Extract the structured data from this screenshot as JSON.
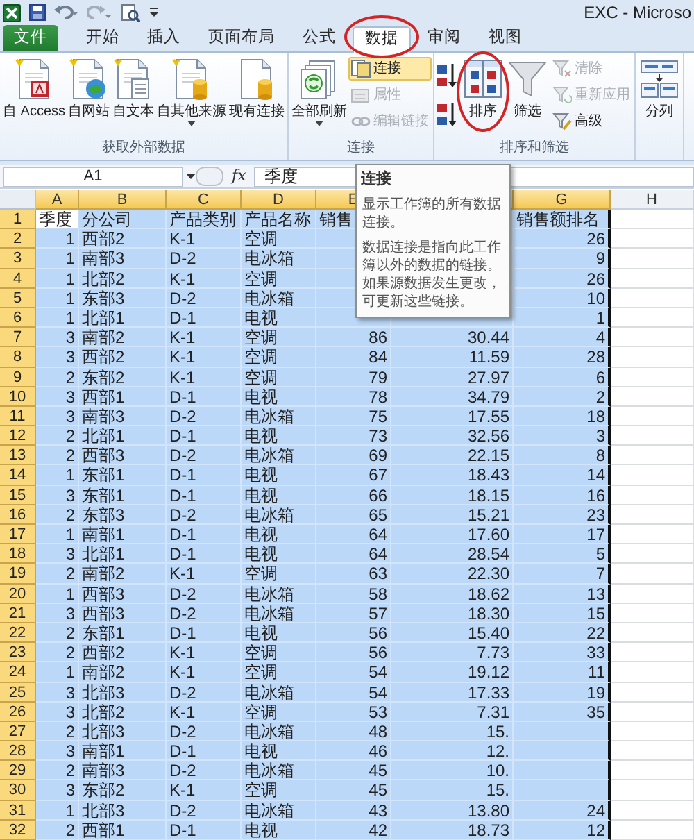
{
  "title_bar": {
    "title": "EXC - Microso"
  },
  "tabs": [
    {
      "label": "文件",
      "kind": "file",
      "selected": false
    },
    {
      "label": "开始",
      "kind": "tab",
      "selected": false
    },
    {
      "label": "插入",
      "kind": "tab",
      "selected": false
    },
    {
      "label": "页面布局",
      "kind": "tab",
      "selected": false
    },
    {
      "label": "公式",
      "kind": "tab",
      "selected": false
    },
    {
      "label": "数据",
      "kind": "tab",
      "selected": true,
      "circled": true
    },
    {
      "label": "审阅",
      "kind": "tab",
      "selected": false
    },
    {
      "label": "视图",
      "kind": "tab",
      "selected": false
    }
  ],
  "ribbon": {
    "groups": [
      {
        "label": "获取外部数据",
        "items": [
          {
            "kind": "large",
            "label": "自 Access",
            "dropdown": false
          },
          {
            "kind": "large",
            "label": "自网站",
            "dropdown": false
          },
          {
            "kind": "large",
            "label": "自文本",
            "dropdown": false
          },
          {
            "kind": "large",
            "label": "自其他来源",
            "dropdown": true
          },
          {
            "kind": "large",
            "label": "现有连接",
            "dropdown": false
          }
        ]
      },
      {
        "label": "连接",
        "items": [
          {
            "kind": "large",
            "label": "全部刷新",
            "dropdown": true
          },
          {
            "kind": "stack",
            "buttons": [
              {
                "label": "连接",
                "disabled": false,
                "highlighted": true
              },
              {
                "label": "属性",
                "disabled": true,
                "highlighted": false
              },
              {
                "label": "编辑链接",
                "disabled": true,
                "highlighted": false
              }
            ]
          }
        ]
      },
      {
        "label": "排序和筛选",
        "items": [
          {
            "kind": "icons",
            "buttons": [
              {
                "disabled": false
              },
              {
                "disabled": false
              }
            ]
          },
          {
            "kind": "large",
            "label": "排序",
            "dropdown": false,
            "circled": true
          },
          {
            "kind": "large",
            "label": "筛选",
            "dropdown": false
          },
          {
            "kind": "stack",
            "buttons": [
              {
                "label": "清除",
                "disabled": true,
                "highlighted": false
              },
              {
                "label": "重新应用",
                "disabled": true,
                "highlighted": false
              },
              {
                "label": "高级",
                "disabled": false,
                "highlighted": false
              }
            ]
          }
        ]
      },
      {
        "items": [
          {
            "kind": "large",
            "label": "分列",
            "dropdown": false
          }
        ]
      }
    ]
  },
  "formula_bar": {
    "name_box": "A1",
    "function_label": "fx",
    "formula": "季度"
  },
  "tooltip": {
    "title": "连接",
    "paragraphs": [
      "显示工作簿的所有数据连接。",
      "数据连接是指向此工作簿以外的数据的链接。如果源数据发生更改，可更新这些链接。"
    ]
  },
  "columns": [
    {
      "label": "A",
      "selected": true,
      "kind": "number"
    },
    {
      "label": "B",
      "selected": true,
      "kind": "text"
    },
    {
      "label": "C",
      "selected": true,
      "kind": "text"
    },
    {
      "label": "D",
      "selected": true,
      "kind": "text"
    },
    {
      "label": "E",
      "selected": true,
      "kind": "number"
    },
    {
      "selected": true,
      "kind": "number"
    },
    {
      "label": "G",
      "selected": true,
      "kind": "number"
    },
    {
      "label": "H",
      "selected": false,
      "kind": "text"
    }
  ],
  "rows": [
    {
      "header": "1",
      "kind": "header",
      "selected": true,
      "cells": [
        "季度",
        "分公司",
        "产品类别",
        "产品名称",
        "销售",
        null,
        "销售额排名"
      ]
    },
    {
      "header": "2",
      "kind": "data",
      "selected": true,
      "cells": [
        "1",
        "西部2",
        "K-1",
        "空调",
        null,
        null,
        "26"
      ]
    },
    {
      "header": "3",
      "kind": "data",
      "selected": true,
      "cells": [
        "1",
        "南部3",
        "D-2",
        "电冰箱",
        null,
        null,
        "9"
      ]
    },
    {
      "header": "4",
      "kind": "data",
      "selected": true,
      "cells": [
        "1",
        "北部2",
        "K-1",
        "空调",
        null,
        null,
        "26"
      ]
    },
    {
      "header": "5",
      "kind": "data",
      "selected": true,
      "cells": [
        "1",
        "东部3",
        "D-2",
        "电冰箱",
        null,
        null,
        "10"
      ]
    },
    {
      "header": "6",
      "kind": "data",
      "selected": true,
      "cells": [
        "1",
        "北部1",
        "D-1",
        "电视",
        null,
        null,
        "1"
      ]
    },
    {
      "header": "7",
      "kind": "data",
      "selected": true,
      "cells": [
        "3",
        "南部2",
        "K-1",
        "空调",
        "86",
        "30.44",
        "4"
      ]
    },
    {
      "header": "8",
      "kind": "data",
      "selected": true,
      "cells": [
        "3",
        "西部2",
        "K-1",
        "空调",
        "84",
        "11.59",
        "28"
      ]
    },
    {
      "header": "9",
      "kind": "data",
      "selected": true,
      "cells": [
        "2",
        "东部2",
        "K-1",
        "空调",
        "79",
        "27.97",
        "6"
      ]
    },
    {
      "header": "10",
      "kind": "data",
      "selected": true,
      "cells": [
        "3",
        "西部1",
        "D-1",
        "电视",
        "78",
        "34.79",
        "2"
      ]
    },
    {
      "header": "11",
      "kind": "data",
      "selected": true,
      "cells": [
        "3",
        "南部3",
        "D-2",
        "电冰箱",
        "75",
        "17.55",
        "18"
      ]
    },
    {
      "header": "12",
      "kind": "data",
      "selected": true,
      "cells": [
        "2",
        "北部1",
        "D-1",
        "电视",
        "73",
        "32.56",
        "3"
      ]
    },
    {
      "header": "13",
      "kind": "data",
      "selected": true,
      "cells": [
        "2",
        "西部3",
        "D-2",
        "电冰箱",
        "69",
        "22.15",
        "8"
      ]
    },
    {
      "header": "14",
      "kind": "data",
      "selected": true,
      "cells": [
        "1",
        "东部1",
        "D-1",
        "电视",
        "67",
        "18.43",
        "14"
      ]
    },
    {
      "header": "15",
      "kind": "data",
      "selected": true,
      "cells": [
        "3",
        "东部1",
        "D-1",
        "电视",
        "66",
        "18.15",
        "16"
      ]
    },
    {
      "header": "16",
      "kind": "data",
      "selected": true,
      "cells": [
        "2",
        "东部3",
        "D-2",
        "电冰箱",
        "65",
        "15.21",
        "23"
      ]
    },
    {
      "header": "17",
      "kind": "data",
      "selected": true,
      "cells": [
        "1",
        "南部1",
        "D-1",
        "电视",
        "64",
        "17.60",
        "17"
      ]
    },
    {
      "header": "18",
      "kind": "data",
      "selected": true,
      "cells": [
        "3",
        "北部1",
        "D-1",
        "电视",
        "64",
        "28.54",
        "5"
      ]
    },
    {
      "header": "19",
      "kind": "data",
      "selected": true,
      "cells": [
        "2",
        "南部2",
        "K-1",
        "空调",
        "63",
        "22.30",
        "7"
      ]
    },
    {
      "header": "20",
      "kind": "data",
      "selected": true,
      "cells": [
        "1",
        "西部3",
        "D-2",
        "电冰箱",
        "58",
        "18.62",
        "13"
      ]
    },
    {
      "header": "21",
      "kind": "data",
      "selected": true,
      "cells": [
        "3",
        "西部3",
        "D-2",
        "电冰箱",
        "57",
        "18.30",
        "15"
      ]
    },
    {
      "header": "22",
      "kind": "data",
      "selected": true,
      "cells": [
        "2",
        "东部1",
        "D-1",
        "电视",
        "56",
        "15.40",
        "22"
      ]
    },
    {
      "header": "23",
      "kind": "data",
      "selected": true,
      "cells": [
        "2",
        "西部2",
        "K-1",
        "空调",
        "56",
        "7.73",
        "33"
      ]
    },
    {
      "header": "24",
      "kind": "data",
      "selected": true,
      "cells": [
        "1",
        "南部2",
        "K-1",
        "空调",
        "54",
        "19.12",
        "11"
      ]
    },
    {
      "header": "25",
      "kind": "data",
      "selected": true,
      "cells": [
        "3",
        "北部3",
        "D-2",
        "电冰箱",
        "54",
        "17.33",
        "19"
      ]
    },
    {
      "header": "26",
      "kind": "data",
      "selected": true,
      "cells": [
        "3",
        "北部2",
        "K-1",
        "空调",
        "53",
        "7.31",
        "35"
      ]
    },
    {
      "header": "27",
      "kind": "data",
      "selected": true,
      "cells": [
        "2",
        "北部3",
        "D-2",
        "电冰箱",
        "48",
        "15.",
        null
      ]
    },
    {
      "header": "28",
      "kind": "data",
      "selected": true,
      "cells": [
        "3",
        "南部1",
        "D-1",
        "电视",
        "46",
        "12.",
        null
      ]
    },
    {
      "header": "29",
      "kind": "data",
      "selected": true,
      "cells": [
        "2",
        "南部3",
        "D-2",
        "电冰箱",
        "45",
        "10.",
        null
      ]
    },
    {
      "header": "30",
      "kind": "data",
      "selected": true,
      "cells": [
        "3",
        "东部2",
        "K-1",
        "空调",
        "45",
        "15.",
        null
      ]
    },
    {
      "header": "31",
      "kind": "data",
      "selected": true,
      "cells": [
        "1",
        "北部3",
        "D-2",
        "电冰箱",
        "43",
        "13.80",
        "24"
      ]
    },
    {
      "header": "32",
      "kind": "data",
      "selected": true,
      "cells": [
        "2",
        "西部1",
        "D-1",
        "电视",
        "42",
        "18.73",
        "12"
      ]
    }
  ]
}
